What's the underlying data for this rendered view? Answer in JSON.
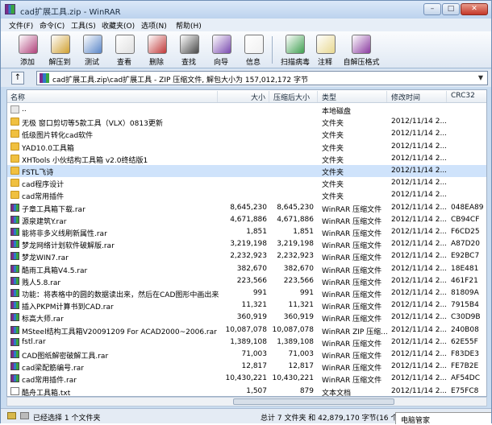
{
  "window": {
    "title": "cad扩展工具.zip - WinRAR",
    "min": "–",
    "max": "□",
    "close": "✕"
  },
  "menu": [
    "文件(F)",
    "命令(C)",
    "工具(S)",
    "收藏夹(O)",
    "选项(N)",
    "帮助(H)"
  ],
  "toolbar": [
    {
      "label": "添加",
      "icon": "add-icon",
      "color": "#b0407a"
    },
    {
      "label": "解压到",
      "icon": "extract-icon",
      "color": "#d0a030"
    },
    {
      "label": "测试",
      "icon": "test-icon",
      "color": "#5a86c8"
    },
    {
      "label": "查看",
      "icon": "view-icon",
      "color": "#e0e0e0"
    },
    {
      "label": "删除",
      "icon": "delete-icon",
      "color": "#c03838"
    },
    {
      "label": "查找",
      "icon": "find-icon",
      "color": "#4a4a4a"
    },
    {
      "label": "向导",
      "icon": "wizard-icon",
      "color": "#7a4ab0"
    },
    {
      "label": "信息",
      "icon": "info-icon",
      "color": "#f0f0f0"
    },
    {
      "label": "扫描病毒",
      "icon": "virus-scan-icon",
      "color": "#40a050"
    },
    {
      "label": "注释",
      "icon": "comment-icon",
      "color": "#e8d890"
    },
    {
      "label": "自解压格式",
      "icon": "sfx-icon",
      "color": "#8a3aa0"
    }
  ],
  "address": {
    "path": "cad扩展工具.zip\\cad扩展工具 - ZIP 压缩文件, 解包大小为 157,012,172 字节"
  },
  "columns": {
    "name": "名称",
    "size": "大小",
    "packed": "压缩后大小",
    "type": "类型",
    "modified": "修改时间",
    "crc": "CRC32"
  },
  "rows": [
    {
      "icon": "up",
      "name": "..",
      "size": "",
      "packed": "",
      "type": "本地磁盘",
      "date": "",
      "crc": ""
    },
    {
      "icon": "folder",
      "name": "无极 窗口剪切等5款工具（VLX）0813更新",
      "size": "",
      "packed": "",
      "type": "文件夹",
      "date": "2012/11/14 2...",
      "crc": ""
    },
    {
      "icon": "folder",
      "name": "低级图片转化cad软件",
      "size": "",
      "packed": "",
      "type": "文件夹",
      "date": "2012/11/14 2...",
      "crc": ""
    },
    {
      "icon": "folder",
      "name": "YAD10.0工具箱",
      "size": "",
      "packed": "",
      "type": "文件夹",
      "date": "2012/11/14 2...",
      "crc": ""
    },
    {
      "icon": "folder",
      "name": "XHTools 小伙结构工具箱 v2.0终结版1",
      "size": "",
      "packed": "",
      "type": "文件夹",
      "date": "2012/11/14 2...",
      "crc": ""
    },
    {
      "icon": "folder",
      "name": "FSTL飞诗",
      "size": "",
      "packed": "",
      "type": "文件夹",
      "date": "2012/11/14 2...",
      "crc": "",
      "selected": true
    },
    {
      "icon": "folder",
      "name": "cad程序设计",
      "size": "",
      "packed": "",
      "type": "文件夹",
      "date": "2012/11/14 2...",
      "crc": ""
    },
    {
      "icon": "folder",
      "name": "cad常用插件",
      "size": "",
      "packed": "",
      "type": "文件夹",
      "date": "2012/11/14 2...",
      "crc": ""
    },
    {
      "icon": "rar",
      "name": "子章工具箱下载.rar",
      "size": "8,645,230",
      "packed": "8,645,230",
      "type": "WinRAR 压缩文件",
      "date": "2012/11/14 2...",
      "crc": "048EA89"
    },
    {
      "icon": "rar",
      "name": "源泉建筑Y.rar",
      "size": "4,671,886",
      "packed": "4,671,886",
      "type": "WinRAR 压缩文件",
      "date": "2012/11/14 2...",
      "crc": "CB94CF"
    },
    {
      "icon": "rar",
      "name": "能将非多义线刷新属性.rar",
      "size": "1,851",
      "packed": "1,851",
      "type": "WinRAR 压缩文件",
      "date": "2012/11/14 2...",
      "crc": "F6CD25"
    },
    {
      "icon": "rar",
      "name": "梦龙网络计划软件破解版.rar",
      "size": "3,219,198",
      "packed": "3,219,198",
      "type": "WinRAR 压缩文件",
      "date": "2012/11/14 2...",
      "crc": "A87D20"
    },
    {
      "icon": "rar",
      "name": "梦龙WIN7.rar",
      "size": "2,232,923",
      "packed": "2,232,923",
      "type": "WinRAR 压缩文件",
      "date": "2012/11/14 2...",
      "crc": "E92BC7"
    },
    {
      "icon": "rar",
      "name": "酷雨工具箱V4.5.rar",
      "size": "382,670",
      "packed": "382,670",
      "type": "WinRAR 压缩文件",
      "date": "2012/11/14 2...",
      "crc": "18E481"
    },
    {
      "icon": "rar",
      "name": "贱人5.8.rar",
      "size": "223,566",
      "packed": "223,566",
      "type": "WinRAR 压缩文件",
      "date": "2012/11/14 2...",
      "crc": "461F21"
    },
    {
      "icon": "rar",
      "name": "功能：将表格中的圆的数据读出来，然后在CAD图形中画出来...",
      "size": "991",
      "packed": "991",
      "type": "WinRAR 压缩文件",
      "date": "2012/11/14 2...",
      "crc": "81809A"
    },
    {
      "icon": "rar",
      "name": "插入PKPM计算书到CAD.rar",
      "size": "11,321",
      "packed": "11,321",
      "type": "WinRAR 压缩文件",
      "date": "2012/11/14 2...",
      "crc": "7915B4"
    },
    {
      "icon": "rar",
      "name": "标高大师.rar",
      "size": "360,919",
      "packed": "360,919",
      "type": "WinRAR 压缩文件",
      "date": "2012/11/14 2...",
      "crc": "C30D9B"
    },
    {
      "icon": "rar",
      "name": "MSteel结构工具箱V20091209 For ACAD2000~2006.rar .zip",
      "size": "10,087,078",
      "packed": "10,087,078",
      "type": "WinRAR ZIP 压缩...",
      "date": "2012/11/14 2...",
      "crc": "240B08"
    },
    {
      "icon": "rar",
      "name": "fstl.rar",
      "size": "1,389,108",
      "packed": "1,389,108",
      "type": "WinRAR 压缩文件",
      "date": "2012/11/14 2...",
      "crc": "62E55F"
    },
    {
      "icon": "rar",
      "name": "CAD图纸解密破解工具.rar",
      "size": "71,003",
      "packed": "71,003",
      "type": "WinRAR 压缩文件",
      "date": "2012/11/14 2...",
      "crc": "F83DE3"
    },
    {
      "icon": "rar",
      "name": "cad梁配筋编号.rar",
      "size": "12,817",
      "packed": "12,817",
      "type": "WinRAR 压缩文件",
      "date": "2012/11/14 2...",
      "crc": "FE7B2E"
    },
    {
      "icon": "rar",
      "name": "cad常用插件.rar",
      "size": "10,430,221",
      "packed": "10,430,221",
      "type": "WinRAR 压缩文件",
      "date": "2012/11/14 2...",
      "crc": "AF54DC"
    },
    {
      "icon": "txt",
      "name": "酷舟工具箱.txt",
      "size": "1,507",
      "packed": "879",
      "type": "文本文档",
      "date": "2012/11/14 2...",
      "crc": "E75FC8"
    }
  ],
  "status": {
    "left": "已经选择 1 个文件夹",
    "right": "总计 7 文件夹 和 42,879,170 字节(16 个文件)"
  },
  "badge": "电脑管家"
}
